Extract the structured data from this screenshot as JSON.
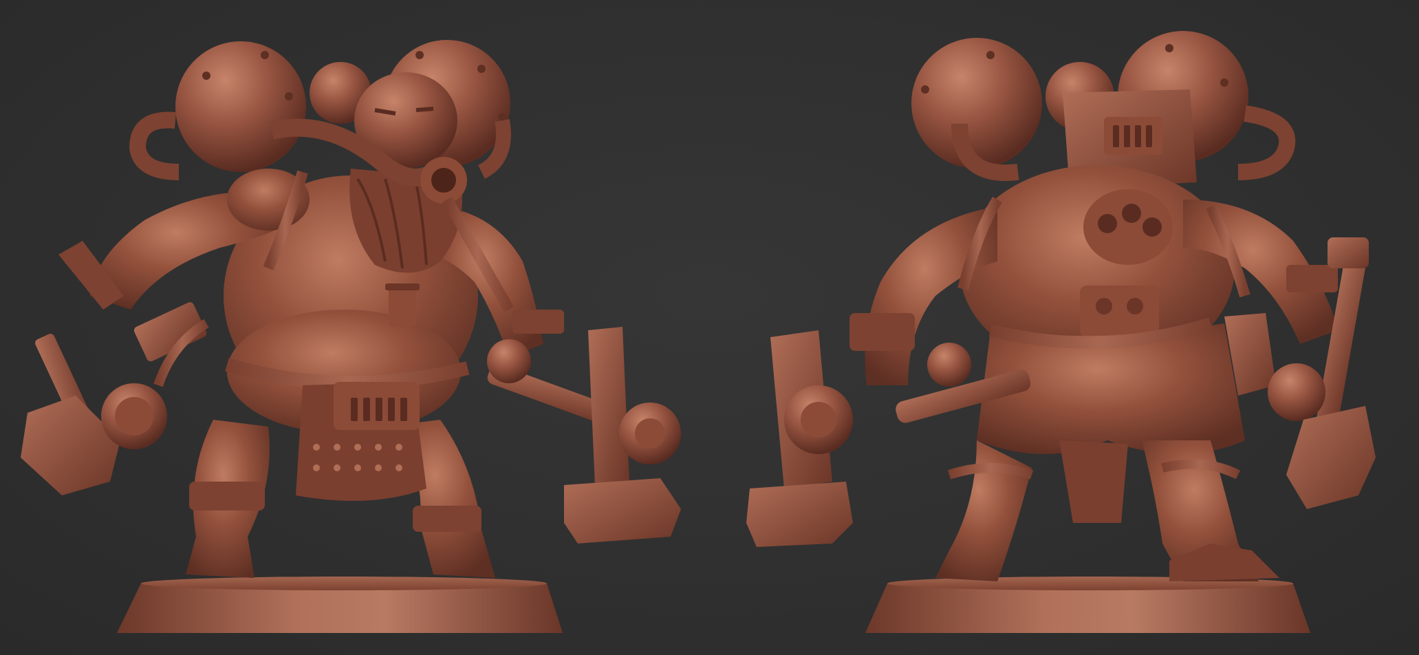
{
  "scene": {
    "background_color": "#303030",
    "clay_color": "#8e4e3a",
    "clay_shadow": "#5a2e22",
    "clay_highlight": "#b97760",
    "views": [
      {
        "name": "front-view",
        "icon": "figure-front"
      },
      {
        "name": "back-view",
        "icon": "figure-back"
      }
    ]
  }
}
